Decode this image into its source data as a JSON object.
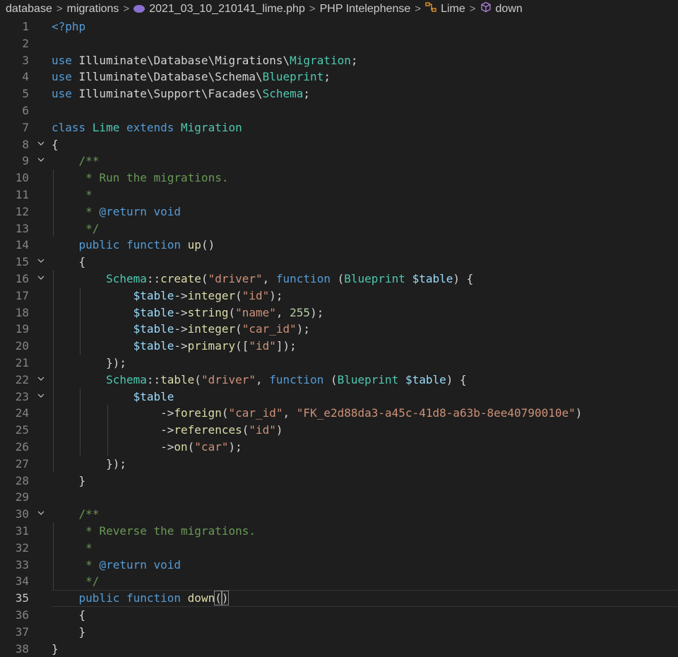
{
  "breadcrumb": {
    "items": [
      {
        "label": "database",
        "icon": ""
      },
      {
        "label": "migrations",
        "icon": ""
      },
      {
        "label": "2021_03_10_210141_lime.php",
        "icon": "php-elephant-icon"
      },
      {
        "label": "PHP Intelephense",
        "icon": ""
      },
      {
        "label": "Lime",
        "icon": "class-icon"
      },
      {
        "label": "down",
        "icon": "method-cube-icon"
      }
    ],
    "separator": ">"
  },
  "colors": {
    "background": "#1e1e1e",
    "keyword": "#569cd6",
    "class": "#4ec9b0",
    "function": "#dcdcaa",
    "string": "#ce9178",
    "variable": "#9cdcfe",
    "number": "#b5cea8",
    "comment": "#6a9955",
    "line_number": "#858585"
  },
  "editor": {
    "active_line": 35,
    "fold_lines": [
      8,
      9,
      15,
      16,
      22,
      23,
      30
    ],
    "lines": [
      [
        [
          "tag",
          "<?php"
        ]
      ],
      [],
      [
        [
          "kw",
          "use "
        ],
        [
          "ns",
          "Illuminate\\Database\\Migrations\\"
        ],
        [
          "cls",
          "Migration"
        ],
        [
          "pun",
          ";"
        ]
      ],
      [
        [
          "kw",
          "use "
        ],
        [
          "ns",
          "Illuminate\\Database\\Schema\\"
        ],
        [
          "cls",
          "Blueprint"
        ],
        [
          "pun",
          ";"
        ]
      ],
      [
        [
          "kw",
          "use "
        ],
        [
          "ns",
          "Illuminate\\Support\\Facades\\"
        ],
        [
          "cls",
          "Schema"
        ],
        [
          "pun",
          ";"
        ]
      ],
      [],
      [
        [
          "kw",
          "class "
        ],
        [
          "cls",
          "Lime "
        ],
        [
          "kw",
          "extends "
        ],
        [
          "cls",
          "Migration"
        ]
      ],
      [
        [
          "pun",
          "{"
        ]
      ],
      [
        [
          "pun",
          "    "
        ],
        [
          "cmt",
          "/**"
        ]
      ],
      [
        [
          "pun",
          "     "
        ],
        [
          "cmt",
          "* Run the migrations."
        ]
      ],
      [
        [
          "pun",
          "     "
        ],
        [
          "cmt",
          "*"
        ]
      ],
      [
        [
          "pun",
          "     "
        ],
        [
          "cmt",
          "* "
        ],
        [
          "kw",
          "@return"
        ],
        [
          "cmt",
          " "
        ],
        [
          "kw",
          "void"
        ]
      ],
      [
        [
          "pun",
          "     "
        ],
        [
          "cmt",
          "*/"
        ]
      ],
      [
        [
          "pun",
          "    "
        ],
        [
          "kw",
          "public "
        ],
        [
          "kw",
          "function "
        ],
        [
          "fn",
          "up"
        ],
        [
          "pun",
          "()"
        ]
      ],
      [
        [
          "pun",
          "    {"
        ]
      ],
      [
        [
          "pun",
          "        "
        ],
        [
          "cls",
          "Schema"
        ],
        [
          "pun",
          "::"
        ],
        [
          "fn",
          "create"
        ],
        [
          "pun",
          "("
        ],
        [
          "str",
          "\"driver\""
        ],
        [
          "pun",
          ", "
        ],
        [
          "kw",
          "function "
        ],
        [
          "pun",
          "("
        ],
        [
          "cls",
          "Blueprint "
        ],
        [
          "var",
          "$table"
        ],
        [
          "pun",
          ") {"
        ]
      ],
      [
        [
          "pun",
          "            "
        ],
        [
          "var",
          "$table"
        ],
        [
          "pun",
          "->"
        ],
        [
          "fn",
          "integer"
        ],
        [
          "pun",
          "("
        ],
        [
          "str",
          "\"id\""
        ],
        [
          "pun",
          ");"
        ]
      ],
      [
        [
          "pun",
          "            "
        ],
        [
          "var",
          "$table"
        ],
        [
          "pun",
          "->"
        ],
        [
          "fn",
          "string"
        ],
        [
          "pun",
          "("
        ],
        [
          "str",
          "\"name\""
        ],
        [
          "pun",
          ", "
        ],
        [
          "num",
          "255"
        ],
        [
          "pun",
          ");"
        ]
      ],
      [
        [
          "pun",
          "            "
        ],
        [
          "var",
          "$table"
        ],
        [
          "pun",
          "->"
        ],
        [
          "fn",
          "integer"
        ],
        [
          "pun",
          "("
        ],
        [
          "str",
          "\"car_id\""
        ],
        [
          "pun",
          ");"
        ]
      ],
      [
        [
          "pun",
          "            "
        ],
        [
          "var",
          "$table"
        ],
        [
          "pun",
          "->"
        ],
        [
          "fn",
          "primary"
        ],
        [
          "pun",
          "(["
        ],
        [
          "str",
          "\"id\""
        ],
        [
          "pun",
          "]);"
        ]
      ],
      [
        [
          "pun",
          "        });"
        ]
      ],
      [
        [
          "pun",
          "        "
        ],
        [
          "cls",
          "Schema"
        ],
        [
          "pun",
          "::"
        ],
        [
          "fn",
          "table"
        ],
        [
          "pun",
          "("
        ],
        [
          "str",
          "\"driver\""
        ],
        [
          "pun",
          ", "
        ],
        [
          "kw",
          "function "
        ],
        [
          "pun",
          "("
        ],
        [
          "cls",
          "Blueprint "
        ],
        [
          "var",
          "$table"
        ],
        [
          "pun",
          ") {"
        ]
      ],
      [
        [
          "pun",
          "            "
        ],
        [
          "var",
          "$table"
        ]
      ],
      [
        [
          "pun",
          "                ->"
        ],
        [
          "fn",
          "foreign"
        ],
        [
          "pun",
          "("
        ],
        [
          "str",
          "\"car_id\""
        ],
        [
          "pun",
          ", "
        ],
        [
          "str",
          "\"FK_e2d88da3-a45c-41d8-a63b-8ee40790010e\""
        ],
        [
          "pun",
          ")"
        ]
      ],
      [
        [
          "pun",
          "                ->"
        ],
        [
          "fn",
          "references"
        ],
        [
          "pun",
          "("
        ],
        [
          "str",
          "\"id\""
        ],
        [
          "pun",
          ")"
        ]
      ],
      [
        [
          "pun",
          "                ->"
        ],
        [
          "fn",
          "on"
        ],
        [
          "pun",
          "("
        ],
        [
          "str",
          "\"car\""
        ],
        [
          "pun",
          ");"
        ]
      ],
      [
        [
          "pun",
          "        });"
        ]
      ],
      [
        [
          "pun",
          "    }"
        ]
      ],
      [],
      [
        [
          "pun",
          "    "
        ],
        [
          "cmt",
          "/**"
        ]
      ],
      [
        [
          "pun",
          "     "
        ],
        [
          "cmt",
          "* Reverse the migrations."
        ]
      ],
      [
        [
          "pun",
          "     "
        ],
        [
          "cmt",
          "*"
        ]
      ],
      [
        [
          "pun",
          "     "
        ],
        [
          "cmt",
          "* "
        ],
        [
          "kw",
          "@return"
        ],
        [
          "cmt",
          " "
        ],
        [
          "kw",
          "void"
        ]
      ],
      [
        [
          "pun",
          "     "
        ],
        [
          "cmt",
          "*/"
        ]
      ],
      [
        [
          "pun",
          "    "
        ],
        [
          "kw",
          "public "
        ],
        [
          "kw",
          "function "
        ],
        [
          "fn",
          "down"
        ],
        [
          "hl",
          "()"
        ]
      ],
      [
        [
          "pun",
          "    {"
        ]
      ],
      [
        [
          "pun",
          "    }"
        ]
      ],
      [
        [
          "pun",
          "}"
        ]
      ]
    ]
  }
}
